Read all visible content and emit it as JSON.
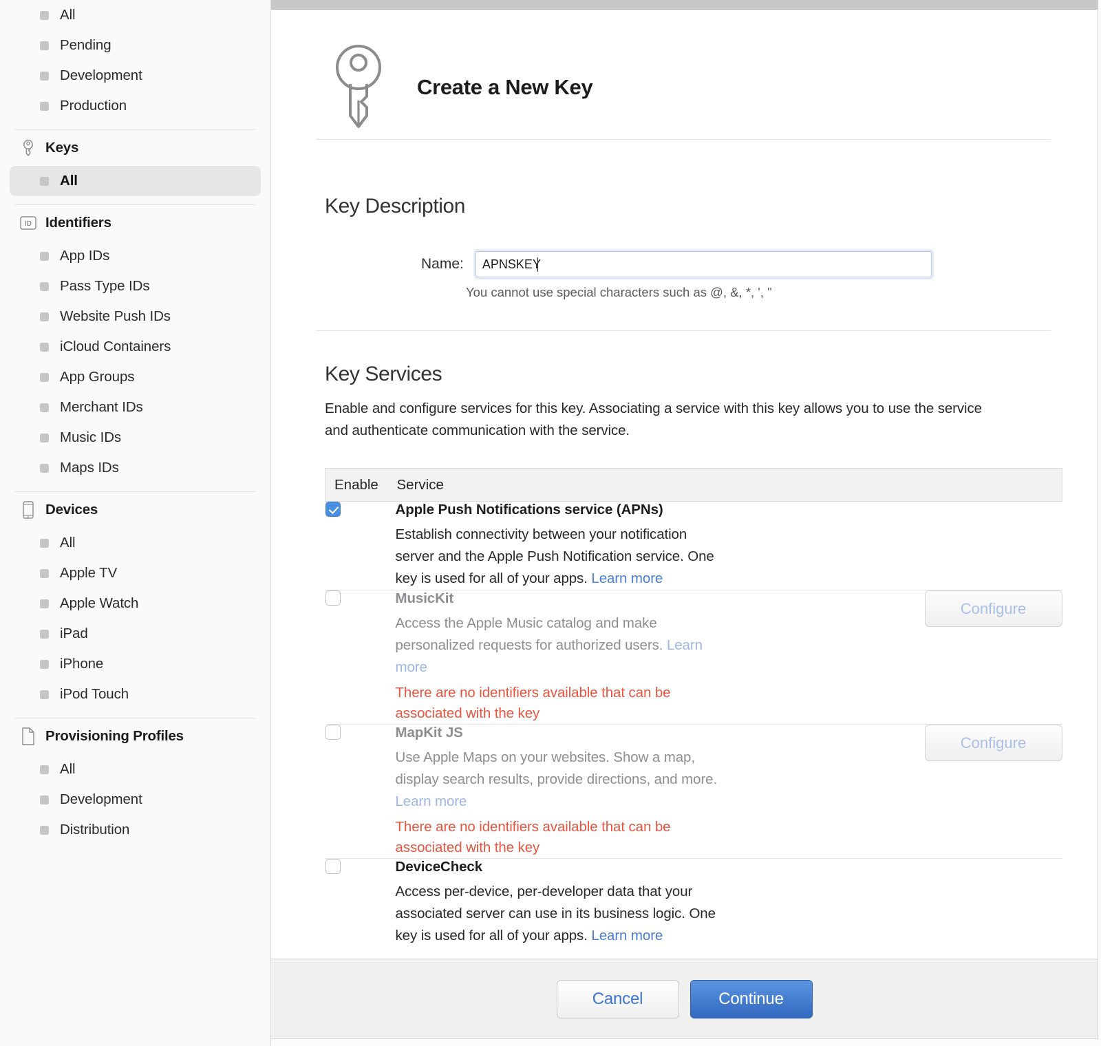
{
  "sidebar": {
    "top_items": [
      {
        "label": "All",
        "selected": false
      },
      {
        "label": "Pending",
        "selected": false
      },
      {
        "label": "Development",
        "selected": false
      },
      {
        "label": "Production",
        "selected": false
      }
    ],
    "sections": [
      {
        "title": "Keys",
        "icon": "key-icon",
        "items": [
          {
            "label": "All",
            "selected": true
          }
        ]
      },
      {
        "title": "Identifiers",
        "icon": "id-icon",
        "items": [
          {
            "label": "App IDs",
            "selected": false
          },
          {
            "label": "Pass Type IDs",
            "selected": false
          },
          {
            "label": "Website Push IDs",
            "selected": false
          },
          {
            "label": "iCloud Containers",
            "selected": false
          },
          {
            "label": "App Groups",
            "selected": false
          },
          {
            "label": "Merchant IDs",
            "selected": false
          },
          {
            "label": "Music IDs",
            "selected": false
          },
          {
            "label": "Maps IDs",
            "selected": false
          }
        ]
      },
      {
        "title": "Devices",
        "icon": "device-icon",
        "items": [
          {
            "label": "All",
            "selected": false
          },
          {
            "label": "Apple TV",
            "selected": false
          },
          {
            "label": "Apple Watch",
            "selected": false
          },
          {
            "label": "iPad",
            "selected": false
          },
          {
            "label": "iPhone",
            "selected": false
          },
          {
            "label": "iPod Touch",
            "selected": false
          }
        ]
      },
      {
        "title": "Provisioning Profiles",
        "icon": "document-icon",
        "items": [
          {
            "label": "All",
            "selected": false
          },
          {
            "label": "Development",
            "selected": false
          },
          {
            "label": "Distribution",
            "selected": false
          }
        ]
      }
    ]
  },
  "main": {
    "header": {
      "icon": "key-icon",
      "title": "Create a New Key"
    },
    "key_description": {
      "section_title": "Key Description",
      "name_label": "Name:",
      "name_value": "APNSKEY",
      "name_placeholder": "",
      "hint": "You cannot use special characters such as @, &, *, ', \""
    },
    "key_services": {
      "section_title": "Key Services",
      "description": "Enable and configure services for this key. Associating a service with this key allows you to use the service and authenticate communication with the service.",
      "columns": {
        "enable": "Enable",
        "service": "Service"
      },
      "learn_more_label": "Learn more",
      "configure_label": "Configure",
      "rows": [
        {
          "name": "Apple Push Notifications service (APNs)",
          "checked": true,
          "dim": false,
          "body": "Establish connectivity between your notification server and the Apple Push Notification service. One key is used for all of your apps.",
          "learn_more": "Learn more",
          "error": "",
          "has_configure": false
        },
        {
          "name": "MusicKit",
          "checked": false,
          "dim": true,
          "body": "Access the Apple Music catalog and make personalized requests for authorized users.",
          "learn_more": "Learn more",
          "error": "There are no identifiers available that can be associated with the key",
          "has_configure": true
        },
        {
          "name": "MapKit JS",
          "checked": false,
          "dim": true,
          "body": "Use Apple Maps on your websites. Show a map, display search results, provide directions, and more.",
          "learn_more": "Learn more",
          "error": "There are no identifiers available that can be associated with the key",
          "has_configure": true
        },
        {
          "name": "DeviceCheck",
          "checked": false,
          "dim": false,
          "body": "Access per-device, per-developer data that your associated server can use in its business logic. One key is used for all of your apps.",
          "learn_more": "Learn more",
          "error": "",
          "has_configure": false
        }
      ]
    },
    "footer": {
      "cancel_label": "Cancel",
      "continue_label": "Continue"
    }
  },
  "colors": {
    "accent_blue": "#4a90e2",
    "link_blue": "#4a7ed6",
    "error_red": "#e8543f",
    "primary_button": "#3268bf"
  }
}
